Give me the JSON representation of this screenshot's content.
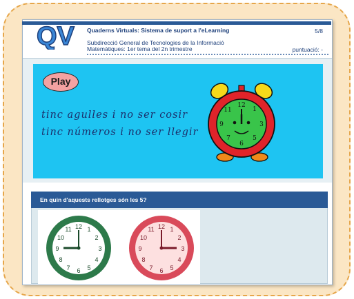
{
  "header": {
    "title": "Quaderns Virtuals: Sistema de suport a l'eLearning",
    "subtitle_line1": "Subdirecció General de Tecnologies de la Informació",
    "subtitle_line2": "Matemàtiques: 1er tema del 2n trimestre",
    "page_indicator": "5/8",
    "score_label": "puntuació: -",
    "logo_text": "QV"
  },
  "activity": {
    "play_label": "Play",
    "riddle_line1": "tinc agulles i no ser cosir",
    "riddle_line2": "tinc números i no ser llegir"
  },
  "question": {
    "text": "En quin d'aquests rellotges són les 5?",
    "options": [
      {
        "name": "green-clock",
        "rim_color": "#2d7a4a",
        "face_color": "#ffffff",
        "time": "9:00"
      },
      {
        "name": "pink-clock",
        "rim_color": "#d94a5a",
        "face_color": "#fde0e0",
        "time": "3:00"
      }
    ]
  },
  "colors": {
    "brand_blue": "#2a5a96",
    "scene_bg": "#1ec4f2",
    "alarm_body": "#e0242a",
    "alarm_face": "#39c44a",
    "alarm_bells": "#f6d91a"
  }
}
